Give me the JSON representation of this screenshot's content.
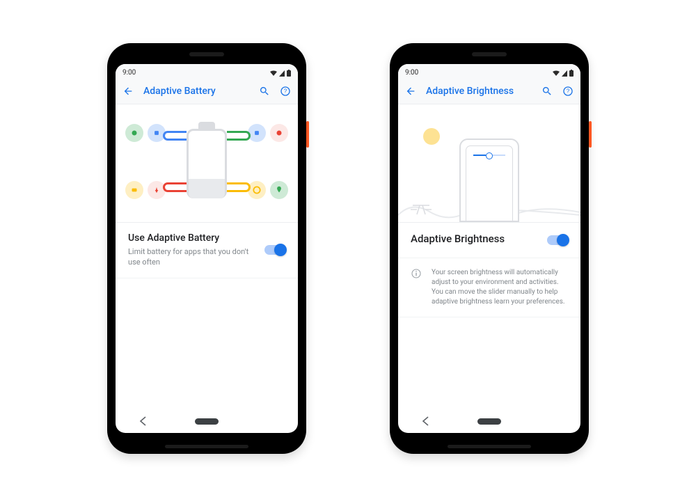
{
  "status_time": "9:00",
  "phones": {
    "battery": {
      "header_title": "Adaptive Battery",
      "setting_title": "Use Adaptive Battery",
      "setting_sub": "Limit battery for apps that you don't use often"
    },
    "brightness": {
      "header_title": "Adaptive Brightness",
      "setting_title": "Adaptive Brightness",
      "info_text": "Your screen brightness will automatically adjust to your environment and activities. You can move the slider manually to help adaptive brightness learn your preferences."
    }
  },
  "colors": {
    "accent": "#1a73e8",
    "g_green": "#34a853",
    "g_red": "#ea4335",
    "g_yellow": "#fbbc04",
    "g_blue": "#4285f4"
  }
}
